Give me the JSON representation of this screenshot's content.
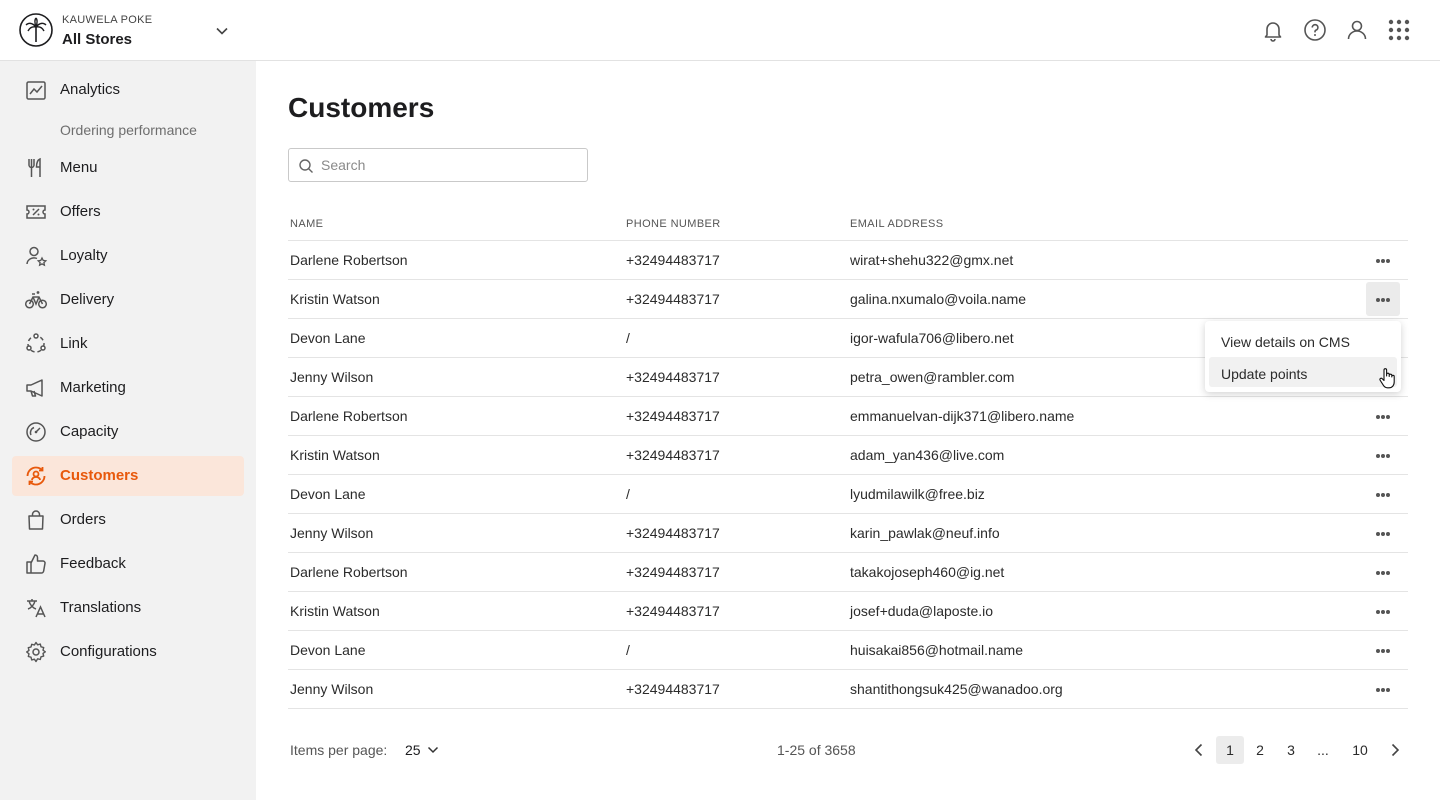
{
  "header": {
    "brand": "KAUWELA POKE",
    "store": "All Stores"
  },
  "sidebar": {
    "items": [
      {
        "label": "Analytics",
        "icon": "analytics-icon"
      },
      {
        "label": "Ordering performance",
        "icon": ""
      },
      {
        "label": "Menu",
        "icon": "fork-knife-icon"
      },
      {
        "label": "Offers",
        "icon": "ticket-percent-icon"
      },
      {
        "label": "Loyalty",
        "icon": "user-star-icon"
      },
      {
        "label": "Delivery",
        "icon": "bicycle-icon"
      },
      {
        "label": "Link",
        "icon": "link-circle-icon"
      },
      {
        "label": "Marketing",
        "icon": "megaphone-icon"
      },
      {
        "label": "Capacity",
        "icon": "gauge-icon"
      },
      {
        "label": "Customers",
        "icon": "customers-icon"
      },
      {
        "label": "Orders",
        "icon": "shopping-bag-icon"
      },
      {
        "label": "Feedback",
        "icon": "thumbs-up-icon"
      },
      {
        "label": "Translations",
        "icon": "translate-icon"
      },
      {
        "label": "Configurations",
        "icon": "gear-icon"
      }
    ],
    "active": "Customers",
    "accent_color": "#e8590c"
  },
  "main": {
    "title": "Customers",
    "search_placeholder": "Search",
    "columns": [
      "NAME",
      "PHONE NUMBER",
      "EMAIL ADDRESS"
    ],
    "rows": [
      {
        "name": "Darlene Robertson",
        "phone": "+32494483717",
        "email": "wirat+shehu322@gmx.net"
      },
      {
        "name": "Kristin Watson",
        "phone": "+32494483717",
        "email": "galina.nxumalo@voila.name"
      },
      {
        "name": "Devon Lane",
        "phone": "/",
        "email": "igor-wafula706@libero.net"
      },
      {
        "name": "Jenny Wilson",
        "phone": "+32494483717",
        "email": "petra_owen@rambler.com"
      },
      {
        "name": "Darlene Robertson",
        "phone": "+32494483717",
        "email": "emmanuelvan-dijk371@libero.name"
      },
      {
        "name": "Kristin Watson",
        "phone": "+32494483717",
        "email": "adam_yan436@live.com"
      },
      {
        "name": "Devon Lane",
        "phone": "/",
        "email": "lyudmilawilk@free.biz"
      },
      {
        "name": "Jenny Wilson",
        "phone": "+32494483717",
        "email": "karin_pawlak@neuf.info"
      },
      {
        "name": "Darlene Robertson",
        "phone": "+32494483717",
        "email": "takakojoseph460@ig.net"
      },
      {
        "name": "Kristin Watson",
        "phone": "+32494483717",
        "email": "josef+duda@laposte.io"
      },
      {
        "name": "Devon Lane",
        "phone": "/",
        "email": "huisakai856@hotmail.name"
      },
      {
        "name": "Jenny Wilson",
        "phone": "+32494483717",
        "email": "shantithongsuk425@wanadoo.org"
      }
    ],
    "row_menu": {
      "items": [
        "View details on CMS",
        "Update points"
      ]
    }
  },
  "footer": {
    "items_per_page_label": "Items per page:",
    "items_per_page_value": "25",
    "range": "1-25 of 3658",
    "pages": [
      "1",
      "2",
      "3",
      "...",
      "10"
    ],
    "current_page": "1"
  }
}
